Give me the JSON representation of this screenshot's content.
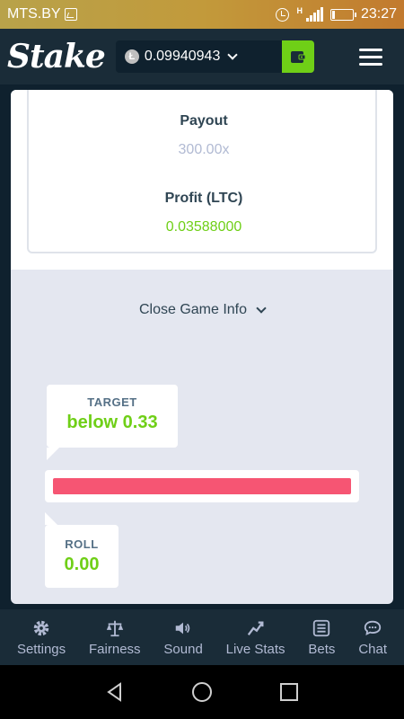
{
  "statusbar": {
    "carrier": "MTS.BY",
    "time": "23:27",
    "network": "H"
  },
  "header": {
    "logo": "Stake",
    "balance": "0.09940943",
    "currency_icon": "litecoin-icon",
    "accent": "#6fcf17"
  },
  "game_info": {
    "payout_label": "Payout",
    "payout_value": "300.00x",
    "profit_label": "Profit (LTC)",
    "profit_value": "0.03588000",
    "close_label": "Close Game Info"
  },
  "result": {
    "target_label": "TARGET",
    "target_value": "below 0.33",
    "roll_label": "ROLL",
    "roll_value": "0.00",
    "bar_color": "#f65573"
  },
  "bottom_nav": [
    {
      "label": "Settings",
      "icon": "gear-icon"
    },
    {
      "label": "Fairness",
      "icon": "scale-icon"
    },
    {
      "label": "Sound",
      "icon": "speaker-icon"
    },
    {
      "label": "Live Stats",
      "icon": "trend-icon"
    },
    {
      "label": "Bets",
      "icon": "list-icon"
    },
    {
      "label": "Chat",
      "icon": "chat-icon"
    }
  ]
}
